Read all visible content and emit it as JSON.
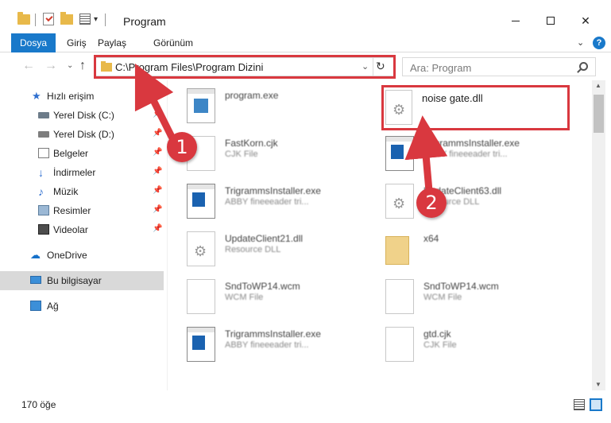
{
  "window": {
    "title": "Program"
  },
  "ribbon": {
    "tabs": [
      {
        "label": "Dosya"
      },
      {
        "label": "Giriş"
      },
      {
        "label": "Paylaş"
      },
      {
        "label": "Görünüm"
      }
    ],
    "help": "?"
  },
  "nav": {
    "back": "←",
    "forward": "→",
    "recent": "⌄",
    "up": "↑",
    "address": "C:\\Program Files\\Program Dizini",
    "refresh": "↻",
    "dropdown": "⌄"
  },
  "search": {
    "placeholder": "Ara: Program"
  },
  "sidebar": {
    "items": [
      {
        "label": "Hızlı erişim",
        "icon": "star-icon",
        "pinned": false
      },
      {
        "label": "Yerel Disk (C:)",
        "icon": "drive-icon",
        "pinned": true
      },
      {
        "label": "Yerel Disk (D:)",
        "icon": "drive-icon",
        "pinned": true
      },
      {
        "label": "Belgeler",
        "icon": "documents-icon",
        "pinned": true
      },
      {
        "label": "İndirmeler",
        "icon": "downloads-icon",
        "pinned": true
      },
      {
        "label": "Müzik",
        "icon": "music-icon",
        "pinned": true
      },
      {
        "label": "Resimler",
        "icon": "pictures-icon",
        "pinned": true
      },
      {
        "label": "Videolar",
        "icon": "videos-icon",
        "pinned": true
      },
      {
        "label": "OneDrive",
        "icon": "cloud-icon",
        "pinned": false
      },
      {
        "label": "Bu bilgisayar",
        "icon": "computer-icon",
        "pinned": false,
        "selected": true
      },
      {
        "label": "Ağ",
        "icon": "network-icon",
        "pinned": false
      }
    ],
    "pin_glyph": "📌"
  },
  "files": [
    {
      "name": "program.exe",
      "type": "",
      "icon": "program-exe-icon"
    },
    {
      "name": "noise gate.dll",
      "type": "",
      "icon": "dll-gear-icon"
    },
    {
      "name": "FastKorn.cjk",
      "type": "CJK File",
      "icon": "generic-file-icon"
    },
    {
      "name": "TrigrammsInstaller.exe",
      "type": "ABBY fineeeader tri...",
      "icon": "installer-exe-icon"
    },
    {
      "name": "TrigrammsInstaller.exe",
      "type": "ABBY fineeeader tri...",
      "icon": "installer-exe-icon"
    },
    {
      "name": "UpdateClient63.dll",
      "type": "Resource DLL",
      "icon": "dll-gear-icon"
    },
    {
      "name": "UpdateClient21.dll",
      "type": "Resource DLL",
      "icon": "dll-gear-icon"
    },
    {
      "name": "x64",
      "type": "",
      "icon": "folder-icon"
    },
    {
      "name": "SndToWP14.wcm",
      "type": "WCM File",
      "icon": "generic-file-icon"
    },
    {
      "name": "SndToWP14.wcm",
      "type": "WCM File",
      "icon": "generic-file-icon"
    },
    {
      "name": "TrigrammsInstaller.exe",
      "type": "ABBY fineeeader tri...",
      "icon": "installer-exe-icon"
    },
    {
      "name": "gtd.cjk",
      "type": "CJK File",
      "icon": "generic-file-icon"
    }
  ],
  "status": {
    "count": "170 öğe"
  },
  "annotations": {
    "marker1": "1",
    "marker2": "2",
    "color": "#d9383f"
  }
}
